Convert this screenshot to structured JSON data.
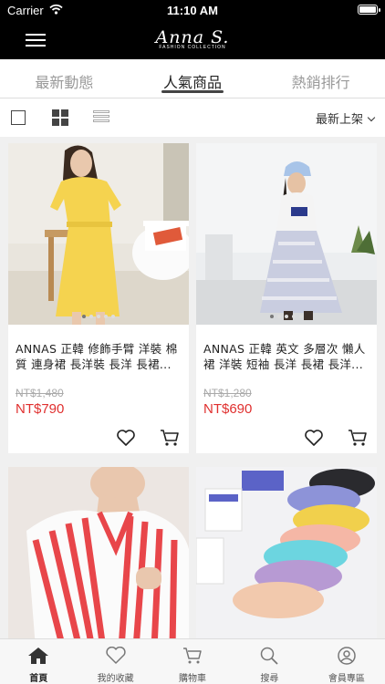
{
  "status": {
    "carrier": "Carrier",
    "time": "11:10 AM"
  },
  "header": {
    "logo_script": "Anna S.",
    "logo_sub": "FASHION COLLECTION"
  },
  "tabs": [
    {
      "label": "最新動態"
    },
    {
      "label": "人氣商品"
    },
    {
      "label": "熱銷排行"
    }
  ],
  "toolbar": {
    "sort_label": "最新上架"
  },
  "products": [
    {
      "name": "ANNAS 正韓 修飾手臂 洋裝 棉質 連身裙 長洋裝 長洋 長裙...",
      "old_price": "NT$1,480",
      "price": "NT$790"
    },
    {
      "name": "ANNAS 正韓 英文 多層次 懶人裙 洋裝 短袖 長洋 長裙 長洋...",
      "old_price": "NT$1,280",
      "price": "NT$690"
    },
    {
      "name": "",
      "old_price": "",
      "price": ""
    },
    {
      "name": "",
      "old_price": "",
      "price": ""
    }
  ],
  "tabbar": [
    {
      "label": "首頁",
      "icon": "home-icon"
    },
    {
      "label": "我的收藏",
      "icon": "heart-icon"
    },
    {
      "label": "購物車",
      "icon": "cart-icon"
    },
    {
      "label": "搜尋",
      "icon": "search-icon"
    },
    {
      "label": "會員專區",
      "icon": "user-icon"
    }
  ],
  "colors": {
    "accent_price": "#e0302f",
    "header_bg": "#000000"
  }
}
